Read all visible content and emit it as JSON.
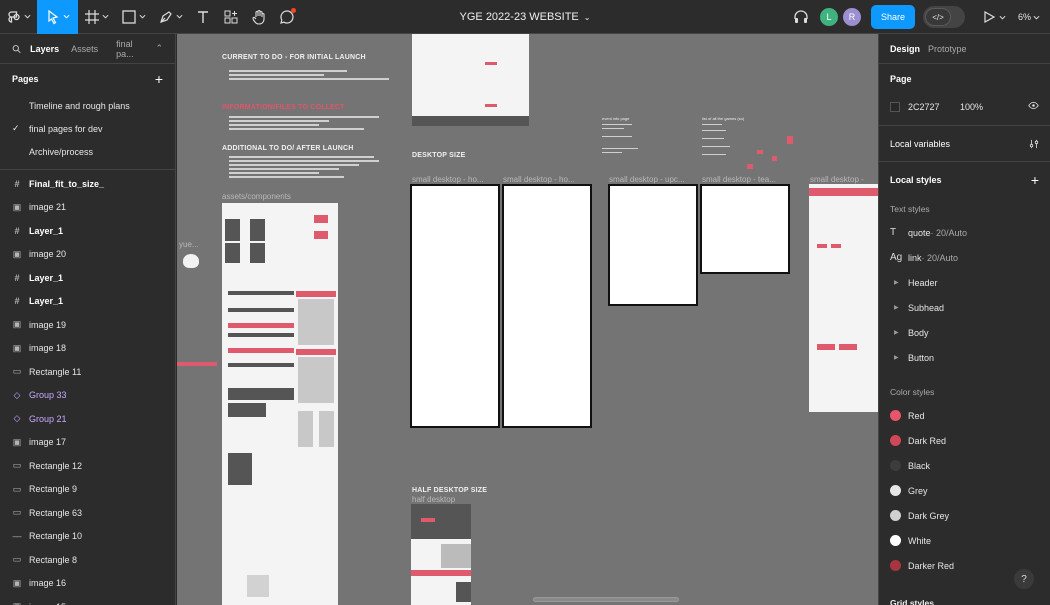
{
  "toolbar": {
    "title": "YGE 2022-23 WEBSITE",
    "share_label": "Share",
    "zoom": "6%",
    "avatars": [
      {
        "initial": "L",
        "color": "#3fb27f"
      },
      {
        "initial": "R",
        "color": "#9b8fd1"
      }
    ],
    "accent": "#0d99ff"
  },
  "left_panel": {
    "tabs": [
      "Layers",
      "Assets",
      "final pa..."
    ],
    "pages_label": "Pages",
    "pages": [
      {
        "label": "Timeline and rough plans",
        "selected": false
      },
      {
        "label": "final pages for dev",
        "selected": true
      },
      {
        "label": "Archive/process",
        "selected": false
      }
    ],
    "layers": [
      {
        "label": "Final_fit_to_size_",
        "icon": "frame-icon",
        "glyph": "#",
        "style": "bold"
      },
      {
        "label": "image 21",
        "icon": "image-icon",
        "glyph": "▣",
        "style": ""
      },
      {
        "label": "Layer_1",
        "icon": "frame-icon",
        "glyph": "#",
        "style": "bold"
      },
      {
        "label": "image 20",
        "icon": "image-icon",
        "glyph": "▣",
        "style": ""
      },
      {
        "label": "Layer_1",
        "icon": "frame-icon",
        "glyph": "#",
        "style": "bold"
      },
      {
        "label": "Layer_1",
        "icon": "frame-icon",
        "glyph": "#",
        "style": "bold"
      },
      {
        "label": "image 19",
        "icon": "image-icon",
        "glyph": "▣",
        "style": ""
      },
      {
        "label": "image 18",
        "icon": "image-icon",
        "glyph": "▣",
        "style": ""
      },
      {
        "label": "Rectangle 11",
        "icon": "rectangle-icon",
        "glyph": "▭",
        "style": ""
      },
      {
        "label": "Group 33",
        "icon": "component-icon",
        "glyph": "◇",
        "style": "purple"
      },
      {
        "label": "Group 21",
        "icon": "component-icon",
        "glyph": "◇",
        "style": "purple"
      },
      {
        "label": "image 17",
        "icon": "image-icon",
        "glyph": "▣",
        "style": ""
      },
      {
        "label": "Rectangle 12",
        "icon": "rectangle-icon",
        "glyph": "▭",
        "style": ""
      },
      {
        "label": "Rectangle 9",
        "icon": "rectangle-icon",
        "glyph": "▭",
        "style": ""
      },
      {
        "label": "Rectangle 63",
        "icon": "rectangle-icon",
        "glyph": "▭",
        "style": ""
      },
      {
        "label": "Rectangle 10",
        "icon": "line-icon",
        "glyph": "—",
        "style": ""
      },
      {
        "label": "Rectangle 8",
        "icon": "rectangle-icon",
        "glyph": "▭",
        "style": ""
      },
      {
        "label": "image 16",
        "icon": "image-icon",
        "glyph": "▣",
        "style": ""
      },
      {
        "label": "image 15",
        "icon": "image-icon",
        "glyph": "▣",
        "style": ""
      }
    ]
  },
  "canvas": {
    "notes": {
      "current_title": "CURRENT TO DO - FOR INITIAL LAUNCH",
      "info_title": "INFORMATION/FILES TO COLLECT",
      "additional_title": "ADDITIONAL TO DO/ AFTER LAUNCH"
    },
    "labels": {
      "assets": "assets/components",
      "desktop_size": "DESKTOP SIZE",
      "half_desktop_size": "HALF DESKTOP SIZE",
      "half_desktop": "half desktop",
      "yue": "yue...",
      "event_info": "event info page",
      "list_games": "list of all the games (so)"
    },
    "frames": [
      "small desktop - ho...",
      "small desktop - ho...",
      "small desktop - upc...",
      "small desktop - tea...",
      "small desktop -"
    ]
  },
  "right_panel": {
    "tabs": [
      "Design",
      "Prototype"
    ],
    "page_label": "Page",
    "page_color": "2C2727",
    "page_opacity": "100%",
    "local_variables": "Local variables",
    "local_styles": "Local styles",
    "text_styles_label": "Text styles",
    "text_styles": [
      {
        "icon": "text-icon",
        "glyph": "T",
        "name": "quote",
        "meta": " · 20/Auto"
      },
      {
        "icon": "link-icon",
        "glyph": "Ag",
        "name": "link",
        "meta": " · 20/Auto"
      }
    ],
    "text_groups": [
      "Header",
      "Subhead",
      "Body",
      "Button"
    ],
    "color_styles_label": "Color styles",
    "color_styles": [
      {
        "name": "Red",
        "hex": "#e8546a"
      },
      {
        "name": "Dark Red",
        "hex": "#d0475a"
      },
      {
        "name": "Black",
        "hex": "#3c3c3c"
      },
      {
        "name": "Grey",
        "hex": "#e6e6e6"
      },
      {
        "name": "Dark Grey",
        "hex": "#cfcfcf"
      },
      {
        "name": "White",
        "hex": "#ffffff"
      },
      {
        "name": "Darker Red",
        "hex": "#a8343f"
      }
    ],
    "grid_styles": "Grid styles",
    "help": "?"
  }
}
